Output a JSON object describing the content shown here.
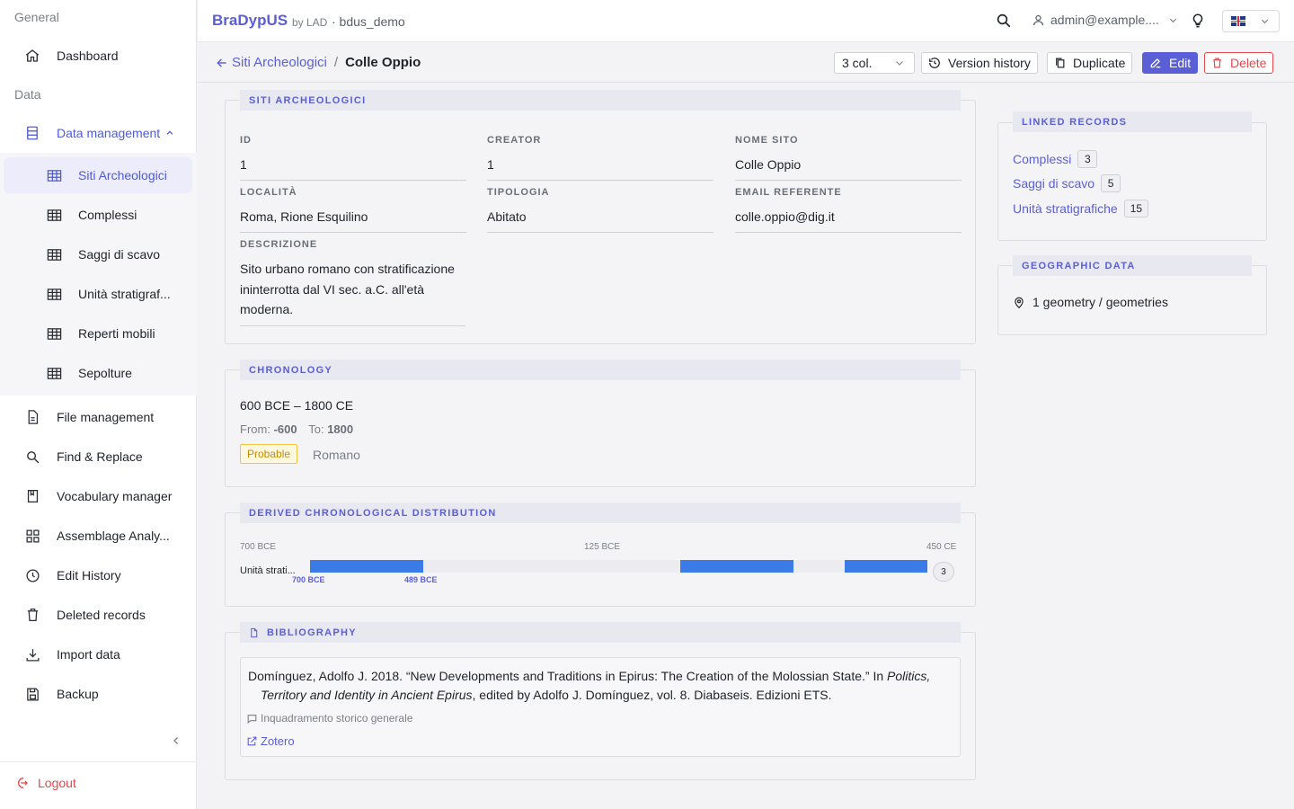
{
  "sidebar": {
    "section_general": "General",
    "section_data": "Data",
    "items": {
      "dashboard": "Dashboard",
      "data_management": "Data management",
      "file_management": "File management",
      "find_replace": "Find & Replace",
      "vocabulary_manager": "Vocabulary manager",
      "assemblage_analysis": "Assemblage Analy...",
      "edit_history": "Edit History",
      "deleted_records": "Deleted records",
      "import_data": "Import data",
      "backup": "Backup"
    },
    "sub_items": {
      "siti": "Siti Archeologici",
      "complessi": "Complessi",
      "saggi": "Saggi di scavo",
      "unita": "Unità stratigraf...",
      "reperti": "Reperti mobili",
      "sepolture": "Sepolture"
    },
    "logout": "Logout"
  },
  "header": {
    "brand": "BraDypUS",
    "brand_by": "by LAD",
    "database": "· bdus_demo",
    "user": "admin@example...."
  },
  "toolbar": {
    "back_label": "Siti Archeologici",
    "separator": "/",
    "current": "Colle Oppio",
    "columns": "3 col.",
    "version_history": "Version history",
    "duplicate": "Duplicate",
    "edit": "Edit",
    "delete": "Delete"
  },
  "record": {
    "section_title": "SITI ARCHEOLOGICI",
    "fields": {
      "id": {
        "label": "ID",
        "value": "1"
      },
      "creator": {
        "label": "CREATOR",
        "value": "1"
      },
      "nome_sito": {
        "label": "NOME SITO",
        "value": "Colle Oppio"
      },
      "localita": {
        "label": "LOCALITÀ",
        "value": "Roma, Rione Esquilino"
      },
      "tipologia": {
        "label": "TIPOLOGIA",
        "value": "Abitato"
      },
      "email": {
        "label": "EMAIL REFERENTE",
        "value": "colle.oppio@dig.it"
      },
      "descrizione": {
        "label": "DESCRIZIONE",
        "value": "Sito urbano romano con stratificazione ininterrotta dal VI sec. a.C. all'età moderna."
      }
    }
  },
  "chronology": {
    "title": "CHRONOLOGY",
    "range": "600 BCE – 1800 CE",
    "from_label": "From:",
    "from_value": "-600",
    "to_label": "To:",
    "to_value": "1800",
    "badge": "Probable",
    "period": "Romano"
  },
  "distribution": {
    "title": "DERIVED CHRONOLOGICAL DISTRIBUTION",
    "tick_start": "700 BCE",
    "tick_mid": "125 BCE",
    "tick_end": "450 CE",
    "row_label": "Unità strati...",
    "marker_start": "700 BCE",
    "marker_end": "489 BCE",
    "count": "3"
  },
  "bibliography": {
    "title": "BIBLIOGRAPHY",
    "citation_pre": "Domínguez, Adolfo J. 2018. “New Developments and Traditions in Epirus: The Creation of the Molossian State.” In ",
    "citation_italic1": "Politics,",
    "citation_italic2": "Territory and Identity in Ancient Epirus",
    "citation_post": ", edited by Adolfo J. Domínguez, vol. 8. Diabaseis. Edizioni ETS.",
    "note": "Inquadramento storico generale",
    "link": "Zotero"
  },
  "linked_records": {
    "title": "LINKED RECORDS",
    "items": [
      {
        "label": "Complessi",
        "count": "3"
      },
      {
        "label": "Saggi di scavo",
        "count": "5"
      },
      {
        "label": "Unità stratigrafiche",
        "count": "15"
      }
    ]
  },
  "geographic": {
    "title": "GEOGRAPHIC DATA",
    "text": "1 geometry / geometries"
  },
  "colors": {
    "accent": "#5b5fd6",
    "danger": "#e5484d",
    "bar": "#3b7be8"
  }
}
